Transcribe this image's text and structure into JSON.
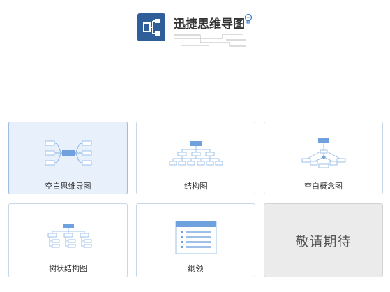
{
  "header": {
    "app_title": "迅捷思维导图",
    "logo_icon": "mindmap-logo-icon",
    "brand_color": "#2f5f98"
  },
  "templates": [
    {
      "label": "空白思维导图",
      "icon": "mindmap-icon",
      "selected": true
    },
    {
      "label": "结构图",
      "icon": "org-chart-icon",
      "selected": false
    },
    {
      "label": "空白概念图",
      "icon": "concept-map-icon",
      "selected": false
    },
    {
      "label": "树状结构图",
      "icon": "tree-chart-icon",
      "selected": false
    },
    {
      "label": "纲领",
      "icon": "outline-icon",
      "selected": false
    },
    {
      "label": "敬请期待",
      "icon": "",
      "selected": false,
      "disabled": true
    }
  ],
  "colors": {
    "card_border": "#c6d7e8",
    "card_selected_bg": "#e8f0fc",
    "icon_blue": "#6fa1de",
    "disabled_bg": "#ebebeb"
  }
}
